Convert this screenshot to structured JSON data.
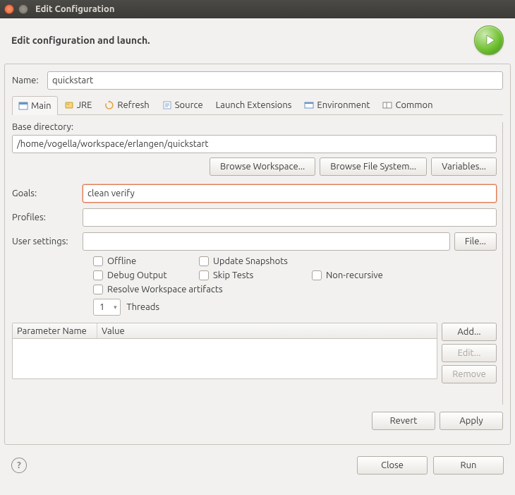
{
  "window": {
    "title": "Edit Configuration"
  },
  "header": {
    "heading": "Edit configuration and launch."
  },
  "name": {
    "label": "Name:",
    "value": "quickstart"
  },
  "tabs": [
    {
      "label": "Main",
      "active": true
    },
    {
      "label": "JRE"
    },
    {
      "label": "Refresh"
    },
    {
      "label": "Source"
    },
    {
      "label": "Launch Extensions"
    },
    {
      "label": "Environment"
    },
    {
      "label": "Common"
    }
  ],
  "main": {
    "base_dir_label": "Base directory:",
    "base_dir": "/home/vogella/workspace/erlangen/quickstart",
    "buttons": {
      "browse_workspace": "Browse Workspace...",
      "browse_fs": "Browse File System...",
      "variables": "Variables..."
    },
    "goals_label": "Goals:",
    "goals": "clean verify",
    "profiles_label": "Profiles:",
    "profiles": "",
    "user_settings_label": "User settings:",
    "user_settings": "",
    "file_btn": "File...",
    "checks": {
      "offline": "Offline",
      "update_snapshots": "Update Snapshots",
      "debug_output": "Debug Output",
      "skip_tests": "Skip Tests",
      "non_recursive": "Non-recursive",
      "resolve_ws": "Resolve Workspace artifacts"
    },
    "threads": {
      "value": "1",
      "label": "Threads"
    },
    "table": {
      "col1": "Parameter Name",
      "col2": "Value",
      "add": "Add...",
      "edit": "Edit...",
      "remove": "Remove"
    }
  },
  "content_footer": {
    "revert": "Revert",
    "apply": "Apply"
  },
  "bottom": {
    "close": "Close",
    "run": "Run"
  }
}
